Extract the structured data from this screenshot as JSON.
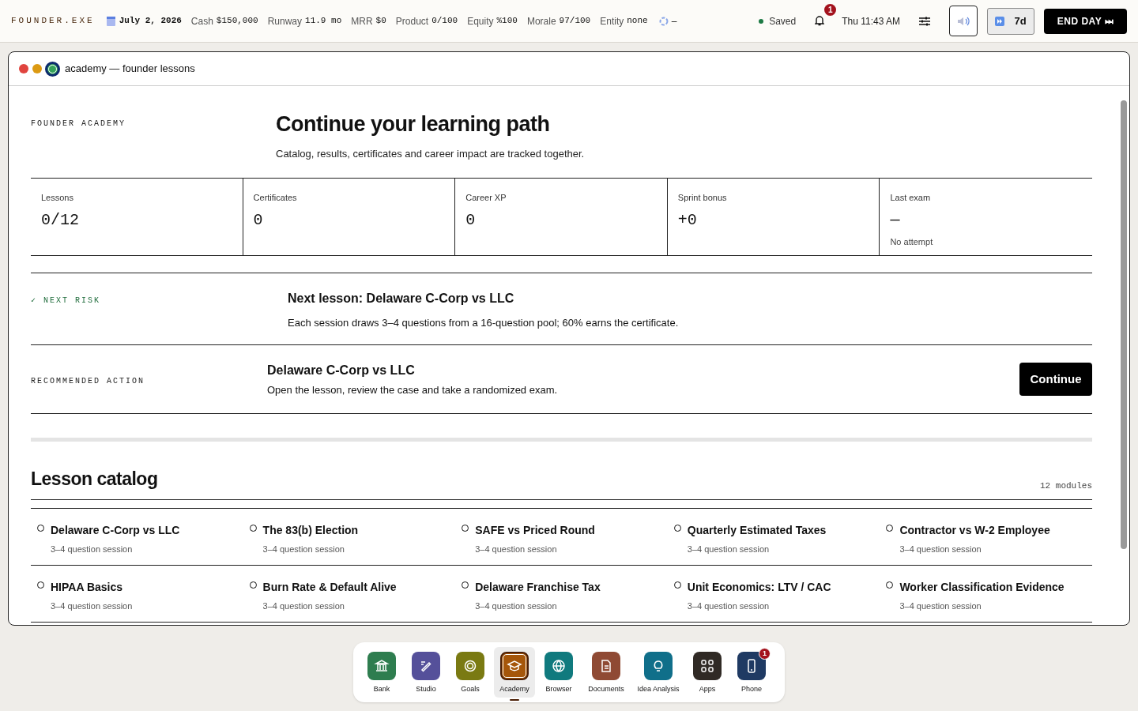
{
  "topbar": {
    "brand": "FOUNDER.EXE",
    "date": "July 2, 2026",
    "stats": [
      {
        "label": "Cash",
        "value": "$150,000"
      },
      {
        "label": "Runway",
        "value": "11.9 mo"
      },
      {
        "label": "MRR",
        "value": "$0"
      },
      {
        "label": "Product",
        "value": "0/100"
      },
      {
        "label": "Equity",
        "value": "%100"
      },
      {
        "label": "Morale",
        "value": "97/100"
      },
      {
        "label": "Entity",
        "value": "none"
      }
    ],
    "sync": "–",
    "saved": "Saved",
    "notifications": "1",
    "clock": "Thu 11:43 AM",
    "speed": "7d",
    "end_day": "END DAY ⏭"
  },
  "window": {
    "title": "academy — founder lessons"
  },
  "hero": {
    "eyebrow": "FOUNDER ACADEMY",
    "title": "Continue your learning path",
    "subtitle": "Catalog, results, certificates and career impact are tracked together."
  },
  "metrics": [
    {
      "label": "Lessons",
      "value": "0/12"
    },
    {
      "label": "Certificates",
      "value": "0"
    },
    {
      "label": "Career XP",
      "value": "0"
    },
    {
      "label": "Sprint bonus",
      "value": "+0"
    },
    {
      "label": "Last exam",
      "value": "—",
      "note": "No attempt"
    }
  ],
  "next_risk": {
    "label": "✓ NEXT RISK",
    "title": "Next lesson: Delaware C-Corp vs LLC",
    "text": "Each session draws 3–4 questions from a 16-question pool; 60% earns the certificate."
  },
  "recommended": {
    "label": "RECOMMENDED ACTION",
    "title": "Delaware C-Corp vs LLC",
    "text": "Open the lesson, review the case and take a randomized exam.",
    "button": "Continue"
  },
  "catalog": {
    "title": "Lesson catalog",
    "count": "12 modules",
    "lessons": [
      {
        "title": "Delaware C-Corp vs LLC",
        "meta": "3–4 question session",
        "done": false
      },
      {
        "title": "The 83(b) Election",
        "meta": "3–4 question session",
        "done": false
      },
      {
        "title": "SAFE vs Priced Round",
        "meta": "3–4 question session",
        "done": false
      },
      {
        "title": "Quarterly Estimated Taxes",
        "meta": "3–4 question session",
        "done": false
      },
      {
        "title": "Contractor vs W-2 Employee",
        "meta": "3–4 question session",
        "done": false
      },
      {
        "title": "HIPAA Basics",
        "meta": "3–4 question session",
        "done": false
      },
      {
        "title": "Burn Rate & Default Alive",
        "meta": "3–4 question session",
        "done": false
      },
      {
        "title": "Delaware Franchise Tax",
        "meta": "3–4 question session",
        "done": false
      },
      {
        "title": "Unit Economics: LTV / CAC",
        "meta": "3–4 question session",
        "done": false
      },
      {
        "title": "Worker Classification Evidence",
        "meta": "3–4 question session",
        "done": false
      }
    ]
  },
  "dock": [
    {
      "label": "Bank",
      "kind": "bank",
      "color": "#2e7d4f",
      "selected": false
    },
    {
      "label": "Studio",
      "kind": "studio",
      "color": "#55509a",
      "selected": false
    },
    {
      "label": "Goals",
      "kind": "goals",
      "color": "#7a7a12",
      "selected": false
    },
    {
      "label": "Academy",
      "kind": "academy",
      "color": "#a5560a",
      "selected": true
    },
    {
      "label": "Browser",
      "kind": "browser",
      "color": "#107a7e",
      "selected": false
    },
    {
      "label": "Documents",
      "kind": "documents",
      "color": "#8f4a34",
      "selected": false
    },
    {
      "label": "Idea Analysis",
      "kind": "idea",
      "color": "#106f8a",
      "selected": false
    },
    {
      "label": "Apps",
      "kind": "apps",
      "color": "#302a25",
      "selected": false
    },
    {
      "label": "Phone",
      "kind": "phone",
      "color": "#1f3a63",
      "selected": false,
      "badge": "1"
    }
  ]
}
